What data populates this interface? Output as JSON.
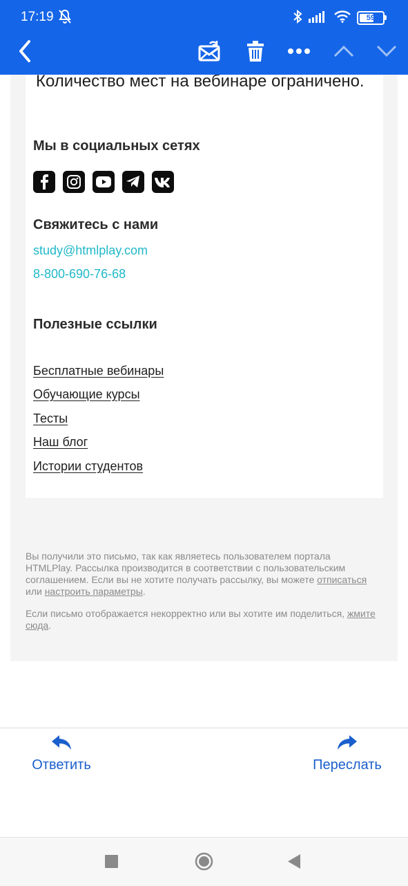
{
  "status_bar": {
    "time": "17:19",
    "battery": "59",
    "icons": [
      "bell-off-icon",
      "bluetooth-icon",
      "signal-icon",
      "wifi-icon",
      "battery-icon"
    ]
  },
  "toolbar": {
    "icons": [
      "back-icon",
      "mark-unread-icon",
      "trash-icon",
      "more-icon",
      "prev-message-icon",
      "next-message-icon"
    ]
  },
  "email": {
    "intro": "Количество мест на вебинаре ограничено.",
    "social_heading": "Мы в социальных сетях",
    "social_icons": [
      "facebook-icon",
      "instagram-icon",
      "youtube-icon",
      "telegram-icon",
      "vk-icon"
    ],
    "contact_heading": "Свяжитесь с нами",
    "contact_email": "study@htmlplay.com",
    "contact_phone": "8-800-690-76-68",
    "links_heading": "Полезные ссылки",
    "links": [
      "Бесплатные вебинары",
      "Обучающие курсы",
      "Тесты",
      "Наш блог",
      "Истории студентов"
    ],
    "footer": {
      "p1_text": "Вы получили это письмо, так как являетесь пользователем портала HTMLPlay. Рассылка производится в соответствии с пользовательским соглашением. Если вы не хотите получать рассылку, вы можете",
      "p1_link1": "отписаться",
      "p1_or": "или",
      "p1_link2": "настроить параметры",
      "p1_end": ".",
      "p2_text": "Если письмо отображается некорректно или вы хотите им поделиться,",
      "p2_link": "жмите сюда",
      "p2_end": "."
    }
  },
  "actions": {
    "reply_label": "Ответить",
    "forward_label": "Переслать"
  },
  "colors": {
    "header_blue": "#1565e8",
    "link_teal": "#21b8c9",
    "action_blue": "#1a5fcc"
  }
}
